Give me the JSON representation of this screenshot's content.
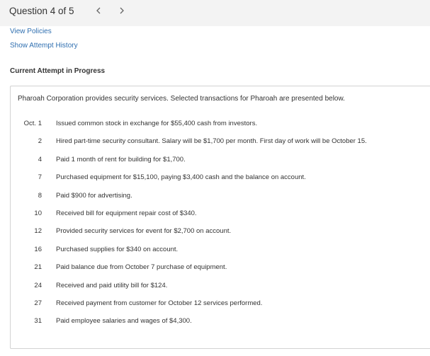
{
  "header": {
    "question_label": "Question 4 of 5",
    "prev_icon": "chevron-left-icon",
    "next_icon": "chevron-right-icon"
  },
  "links": {
    "view_policies": "View Policies",
    "show_attempt_history": "Show Attempt History"
  },
  "attempt": {
    "title": "Current Attempt in Progress"
  },
  "problem": {
    "intro": "Pharoah Corporation provides security services. Selected transactions for Pharoah are presented below.",
    "transactions": [
      {
        "date": "Oct. 1",
        "desc": "Issued common stock in exchange for $55,400 cash from investors."
      },
      {
        "date": "2",
        "desc": "Hired part-time security consultant. Salary will be $1,700 per month. First day of work will be October 15."
      },
      {
        "date": "4",
        "desc": "Paid 1 month of rent for building for $1,700."
      },
      {
        "date": "7",
        "desc": "Purchased equipment for $15,100, paying $3,400 cash and the balance on account."
      },
      {
        "date": "8",
        "desc": "Paid $900 for advertising."
      },
      {
        "date": "10",
        "desc": "Received bill for equipment repair cost of $340."
      },
      {
        "date": "12",
        "desc": "Provided security services for event for $2,700 on account."
      },
      {
        "date": "16",
        "desc": "Purchased supplies for $340 on account."
      },
      {
        "date": "21",
        "desc": "Paid balance due from October 7 purchase of equipment."
      },
      {
        "date": "24",
        "desc": "Received and paid utility bill for $124."
      },
      {
        "date": "27",
        "desc": "Received payment from customer for October 12 services performed."
      },
      {
        "date": "31",
        "desc": "Paid employee salaries and wages of $4,300."
      }
    ]
  },
  "colors": {
    "link": "#2f6fb0",
    "topbar_bg": "#f3f3f3",
    "text": "#333333",
    "panel_border": "#d2d2d2"
  }
}
